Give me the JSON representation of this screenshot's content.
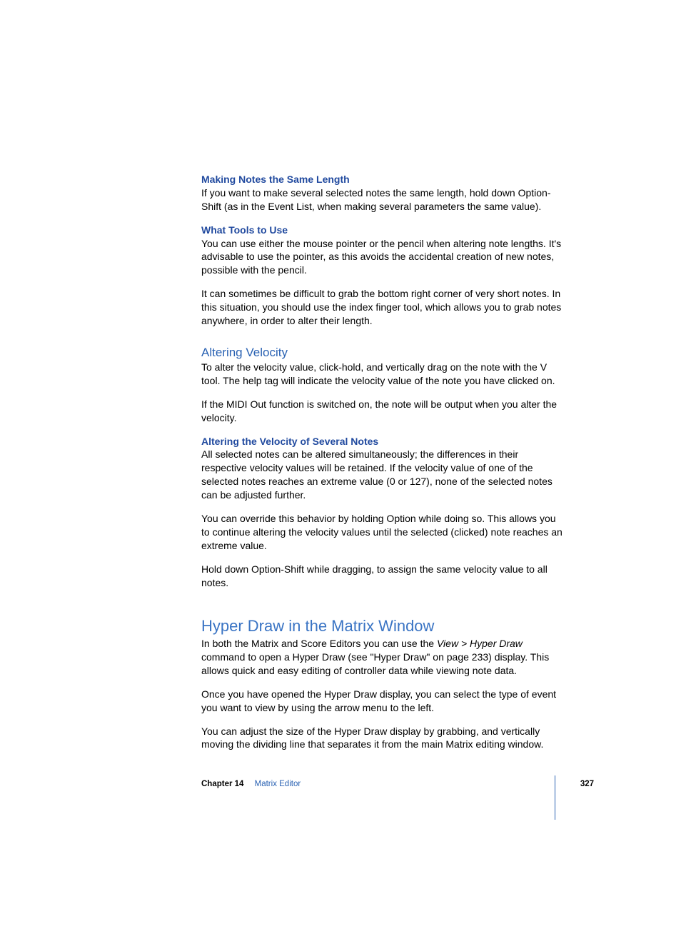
{
  "sec1": {
    "h": "Making Notes the Same Length",
    "p": "If you want to make several selected notes the same length, hold down Option-Shift (as in the Event List, when making several parameters the same value)."
  },
  "sec2": {
    "h": "What Tools to Use",
    "p1": "You can use either the mouse pointer or the pencil when altering note lengths. It's advisable to use the pointer, as this avoids the accidental creation of new notes, possible with the pencil.",
    "p2": "It can sometimes be difficult to grab the bottom right corner of very short notes. In this situation, you should use the index finger tool, which allows you to grab notes anywhere, in order to alter their length."
  },
  "sec3": {
    "h": "Altering Velocity",
    "p1": "To alter the velocity value, click-hold, and vertically drag on the note with the V tool. The help tag will indicate the velocity value of the note you have clicked on.",
    "p2": "If the MIDI Out function is switched on, the note will be output when you alter the velocity."
  },
  "sec4": {
    "h": "Altering the Velocity of Several Notes",
    "p1": "All selected notes can be altered simultaneously; the differences in their respective velocity values will be retained. If the velocity value of one of the selected notes reaches an extreme value (0 or 127), none of the selected notes can be adjusted further.",
    "p2": "You can override this behavior by holding Option while doing so. This allows you to continue altering the velocity values until the selected (clicked) note reaches an extreme value.",
    "p3": "Hold down Option-Shift while dragging, to assign the same velocity value to all notes."
  },
  "sec5": {
    "h": "Hyper Draw in the Matrix Window",
    "p1a": "In both the Matrix and Score Editors you can use the ",
    "p1b": "View > Hyper Draw",
    "p1c": " command to open a Hyper Draw (see \"Hyper Draw\" on page 233) display. This allows quick and easy editing of controller data while viewing note data.",
    "p2": "Once you have opened the Hyper Draw display, you can select the type of event you want to view by using the arrow menu to the left.",
    "p3": "You can adjust the size of the Hyper Draw display by grabbing, and vertically moving the dividing line that separates it from the main Matrix editing window."
  },
  "footer": {
    "chapter": "Chapter 14",
    "title": "Matrix Editor",
    "page": "327"
  }
}
